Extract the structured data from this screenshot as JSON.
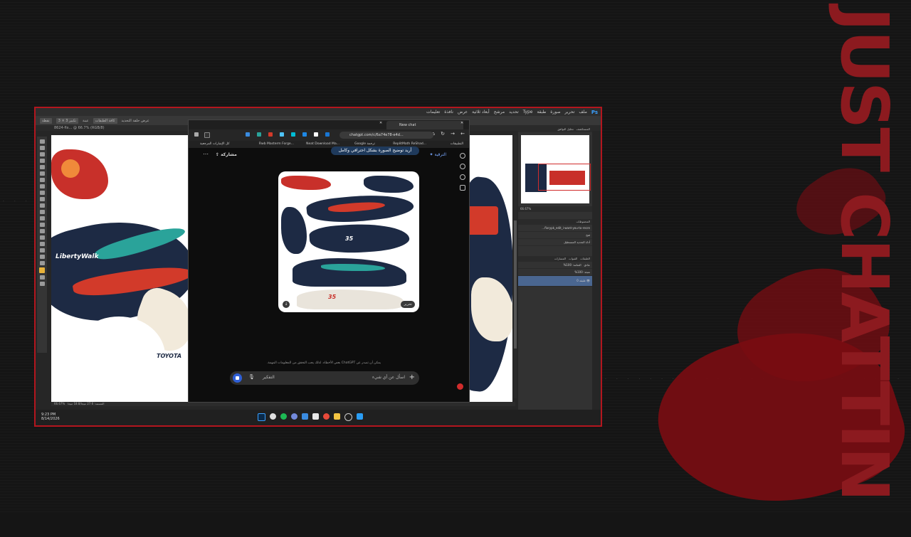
{
  "overlay": {
    "side_title": "JUST CHATTIN"
  },
  "photoshop": {
    "logo": "Ps",
    "menu": [
      "ملف",
      "تحرير",
      "صورة",
      "طبقة",
      "Type",
      "تحديد",
      "مرشح",
      "أبعاد ثلاثية",
      "عرض",
      "نافذة",
      "تعليمات"
    ],
    "options": [
      "نقطة",
      "تكبير 3 × 3",
      "عينة",
      "كافة الطبقات",
      "عرض حلقة التحديد"
    ],
    "doc_tab": "8624-fix... @ 66.7% (RGB/8)",
    "zoom_status": "66.67%",
    "doc_status": "المستند: 27.6 ميجا/18.8 ميجا",
    "panels": {
      "nav_tabs": [
        "المستكشف",
        "تحليل التوافق"
      ],
      "zoom": "66.67%",
      "history_tab": "المحفوظات",
      "history_items": [
        "fixrypk_edit_i-want-you-to-recre...",
        "فتح",
        "أداة التحديد المستطيل"
      ],
      "layers_tabs": [
        "الطبقات",
        "القنوات",
        "المسارات"
      ],
      "blend_mode": "عادي",
      "opacity_label": "العتامة:",
      "opacity": "100%",
      "fill_label": "تعبئة:",
      "fill": "100%",
      "layer_name": "طبقة 0"
    },
    "livery_texts": [
      "LibertyWalk",
      "TOYOTA"
    ]
  },
  "chrome": {
    "tab_title": "New chat",
    "url": "chatgpt.com/c/6a74e78-e4d...",
    "bookmarks": [
      "التطبيقات",
      "ReplitMath ReShad...",
      "Google ترجمة",
      "Neat Download Ma...",
      "Rwb Masterm Forge...",
      "كل الإشارات المرجعية"
    ]
  },
  "chatgpt": {
    "upgrade": "الترقية",
    "share": "مشاركة",
    "user_message": "أريد توضيح الصورة بشكل احترافي وكامل",
    "edit_label": "تحرير",
    "disclaimer": "يمكن أن تصدر عن ChatGPT بعض الأخطاء. لذلك يجب التحقق من المعلومات المهمة.",
    "input_placeholder": "اسأل عن أي شيء",
    "thinking_label": "التفكير",
    "car_number": "35"
  },
  "taskbar": {
    "time": "9:23 PM",
    "date": "8/14/2026"
  },
  "colors": {
    "accent_red": "#b3161e",
    "chatgpt_blue": "#2f5fd6",
    "ps_blue": "#3aa0ff"
  }
}
